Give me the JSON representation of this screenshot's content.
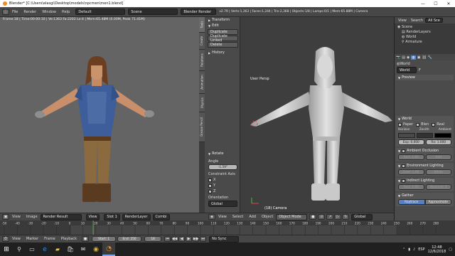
{
  "window": {
    "title": "Blender* [C:\\Users\\elasgi\\Desktop\\models\\npcmen\\men1.blend]",
    "controls": {
      "minimize": "—",
      "maximize": "☐",
      "close": "✕"
    }
  },
  "menu": {
    "items": [
      "File",
      "Render",
      "Window",
      "Help"
    ],
    "screen_layout": "Default",
    "scene": "Scene",
    "render_engine": "Blender Render",
    "stats": "v2.79 | Verts:1,363 | Faces:1,244 | Tris:2,368 | Objects:1/8 | Lamps:0/1 | Mem:65.88M | Camera"
  },
  "left_view": {
    "stats": "Frame:18 | Time:00:00:10 | Ve:1363 Fa:2202 Lo:4 | Mem:65.48M (0.00M, Peak 71.41M)"
  },
  "tool_shelf": {
    "tabs": [
      "Tools",
      "Create",
      "Relations",
      "Animation",
      "Physics",
      "Grease Pencil"
    ],
    "transform_label": "Transform",
    "edit_label": "Edit",
    "edit_buttons": [
      "Duplicate",
      "Duplicate Linked",
      "Delete"
    ],
    "history_label": "History",
    "rotate_panel": {
      "title": "Rotate",
      "angle_label": "Angle",
      "angle_value": "-1.59°",
      "constraint_label": "Constraint Axis",
      "axes": [
        "X",
        "Y",
        "Z"
      ],
      "orientation_label": "Orientation",
      "orientation_value": "Global"
    }
  },
  "right_view": {
    "perspective_label": "User Persp",
    "camera_label": "(18) Camera"
  },
  "outliner": {
    "header_items": [
      "View",
      "Search",
      "All Sce"
    ],
    "tree": [
      "Scene",
      "RenderLayers",
      "World",
      "Armature"
    ]
  },
  "properties": {
    "world_name": "World",
    "f_label": "F",
    "preview_label": "Preview",
    "world_section": "World",
    "world_checkboxes": [
      "Paper",
      "Blen",
      "Real"
    ],
    "horizon_label": "Horizon",
    "zenith_label": "Zenith",
    "ambient_label": "Ambient",
    "exposure_value": "Exp: 0.000",
    "range_value": "Ra: 1.000",
    "ambient_occlusion": "Ambient Occlusion",
    "ao_factor": "Fact: 1.00",
    "ao_blend": "Add",
    "env_lighting": "Environment Lighting",
    "env_energy": "Ener: 1.00",
    "env_color": "White",
    "indirect_lighting": "Indirect Lighting",
    "il_factor": "Fact: 1.00",
    "il_bounces": "Bounces: 1",
    "gather_label": "Gather",
    "gather_options": [
      "Raytrace",
      "Approximate"
    ]
  },
  "left_footer": {
    "items": [
      "View",
      "Image"
    ],
    "image_name": "Render Result",
    "view_label": "View",
    "slot_label": "Slot 1",
    "layer_label": "RenderLayer",
    "pass_label": "Combi"
  },
  "right_footer": {
    "items": [
      "View",
      "Select",
      "Add",
      "Object"
    ],
    "mode": "Object Mode",
    "orientation": "Global"
  },
  "timeline": {
    "ticks": [
      "-50",
      "-40",
      "-30",
      "-20",
      "-10",
      "0",
      "10",
      "20",
      "30",
      "40",
      "50",
      "60",
      "70",
      "80",
      "90",
      "100",
      "110",
      "120",
      "130",
      "140",
      "150",
      "160",
      "170",
      "180",
      "190",
      "200",
      "210",
      "220",
      "230",
      "240",
      "250",
      "260",
      "270",
      "280"
    ],
    "current_frame_value": 18,
    "menu": [
      "View",
      "Marker",
      "Frame",
      "Playback"
    ],
    "start": "Start:",
    "start_value": "1",
    "end": "End:",
    "end_value": "250",
    "current_frame": "18",
    "sync": "No Sync"
  },
  "taskbar": {
    "lang": "ESP",
    "time": "12:48",
    "date": "12/6/2018"
  },
  "colors": {
    "accent_orange": "#f08a24",
    "selected_blue": "#5680c2",
    "frame_green": "#4fb34f"
  }
}
